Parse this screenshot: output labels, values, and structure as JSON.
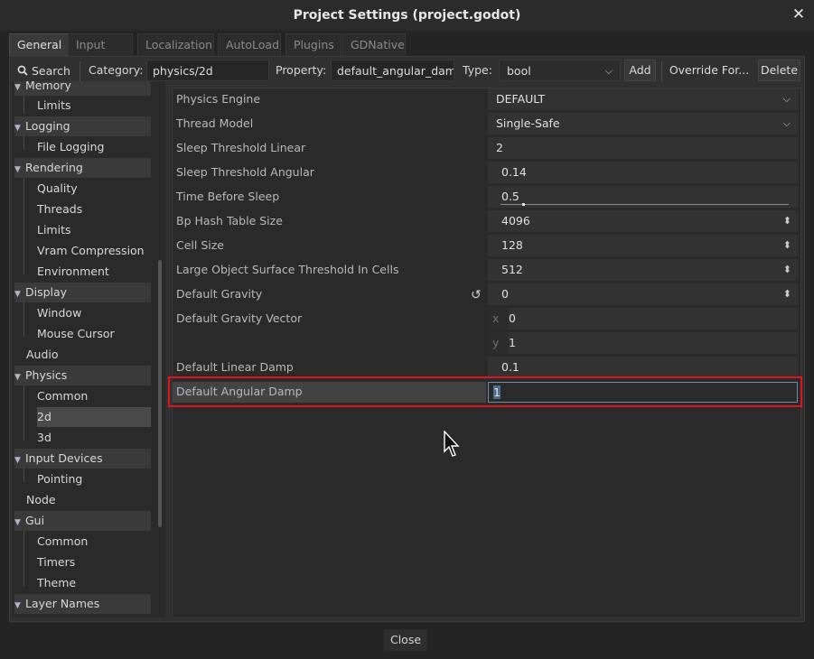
{
  "window": {
    "title": "Project Settings (project.godot)"
  },
  "tabs": [
    "General",
    "Input Map",
    "Localization",
    "AutoLoad",
    "Plugins",
    "GDNative"
  ],
  "toolbar": {
    "search_label": "Search",
    "category_label": "Category:",
    "category_value": "physics/2d",
    "property_label": "Property:",
    "property_value": "default_angular_dam",
    "type_label": "Type:",
    "type_value": "bool",
    "add_label": "Add",
    "override_label": "Override For...",
    "delete_label": "Delete"
  },
  "tree": {
    "items": [
      {
        "label": "Memory",
        "section": true
      },
      {
        "label": "Limits"
      },
      {
        "label": "Logging",
        "section": true
      },
      {
        "label": "File Logging"
      },
      {
        "label": "Rendering",
        "section": true
      },
      {
        "label": "Quality"
      },
      {
        "label": "Threads"
      },
      {
        "label": "Limits"
      },
      {
        "label": "Vram Compression"
      },
      {
        "label": "Environment"
      },
      {
        "label": "Display",
        "section": true
      },
      {
        "label": "Window"
      },
      {
        "label": "Mouse Cursor"
      },
      {
        "label": "Audio"
      },
      {
        "label": "Physics",
        "section": true
      },
      {
        "label": "Common"
      },
      {
        "label": "2d",
        "selected": true
      },
      {
        "label": "3d"
      },
      {
        "label": "Input Devices",
        "section": true
      },
      {
        "label": "Pointing"
      },
      {
        "label": "Node"
      },
      {
        "label": "Gui",
        "section": true
      },
      {
        "label": "Common"
      },
      {
        "label": "Timers"
      },
      {
        "label": "Theme"
      },
      {
        "label": "Layer Names",
        "section": true
      }
    ]
  },
  "properties": [
    {
      "label": "Physics Engine",
      "value": "DEFAULT",
      "kind": "dropdown"
    },
    {
      "label": "Thread Model",
      "value": "Single-Safe",
      "kind": "dropdown"
    },
    {
      "label": "Sleep Threshold Linear",
      "value": "2",
      "kind": "text"
    },
    {
      "label": "Sleep Threshold Angular",
      "value": "0.14",
      "kind": "text"
    },
    {
      "label": "Time Before Sleep",
      "value": "0.5",
      "kind": "slider",
      "level": 0.08
    },
    {
      "label": "Bp Hash Table Size",
      "value": "4096",
      "kind": "spin"
    },
    {
      "label": "Cell Size",
      "value": "128",
      "kind": "spin"
    },
    {
      "label": "Large Object Surface Threshold In Cells",
      "value": "512",
      "kind": "spin"
    },
    {
      "label": "Default Gravity",
      "value": "0",
      "kind": "spin",
      "revert": true
    },
    {
      "label": "Default Gravity Vector",
      "x": "0",
      "y": "1",
      "kind": "vector"
    },
    {
      "label": "Default Linear Damp",
      "value": "0.1",
      "kind": "text"
    },
    {
      "label": "Default Angular Damp",
      "value": "1",
      "kind": "editing"
    }
  ],
  "vector_axes": {
    "x": "x",
    "y": "y"
  },
  "footer": {
    "close_label": "Close"
  },
  "colors": {
    "highlight": "#e0141c",
    "selection": "#4d6b8a"
  }
}
